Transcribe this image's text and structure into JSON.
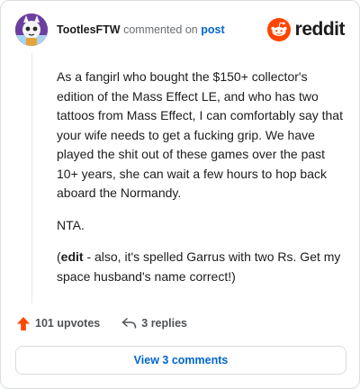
{
  "header": {
    "username": "TootlesFTW",
    "action_text": "commented on",
    "post_link": "post",
    "brand": "reddit"
  },
  "comment": {
    "paragraph1": "As a fangirl who bought the $150+ collector's edition of the Mass Effect LE, and who has two tattoos from Mass Effect, I can comfortably say that your wife needs to get a fucking grip. We have played the shit out of these games over the past 10+ years, she can wait a few hours to hop back aboard the Normandy.",
    "paragraph2": "NTA.",
    "paragraph3_open": "(",
    "paragraph3_bold": "edit",
    "paragraph3_rest": " - also, it's spelled Garrus with two Rs. Get my space husband's name correct!)"
  },
  "actions": {
    "upvotes": "101 upvotes",
    "replies": "3 replies"
  },
  "view_button": "View 3 comments",
  "colors": {
    "upvote": "#ff4500",
    "link": "#0066cc",
    "brand": "#ff4500",
    "avatar_bg": "#6b3fa0"
  }
}
